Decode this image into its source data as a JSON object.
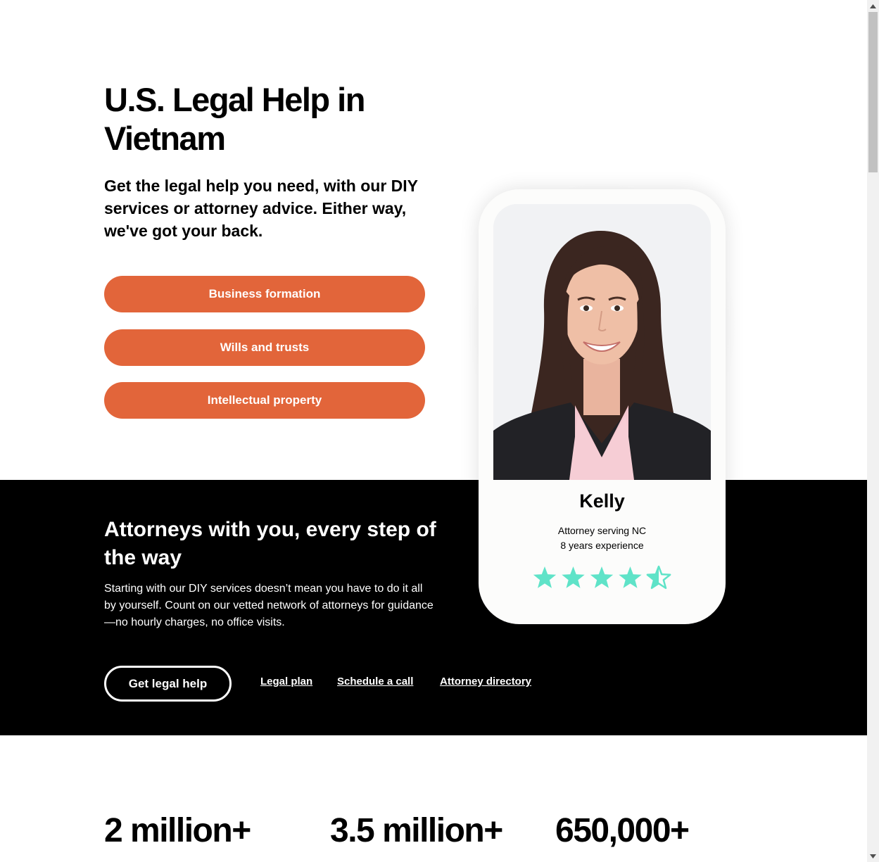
{
  "hero": {
    "title": "U.S. Legal Help in Vietnam",
    "subtitle": "Get the legal help you need, with our DIY services or attorney advice. Either way, we've got your back.",
    "buttons": [
      "Business formation",
      "Wills and trusts",
      "Intellectual property"
    ]
  },
  "band": {
    "title": "Attorneys with you, every step of the way",
    "text": "Starting with our DIY services doesn’t mean you have to do it all by yourself. Count on our vetted network of attorneys for guidance—no hourly charges, no office visits.",
    "primary_button": "Get legal help",
    "links": [
      "Legal plan",
      "Schedule a call",
      "Attorney directory"
    ]
  },
  "attorney_card": {
    "name": "Kelly",
    "role": "Attorney serving NC",
    "experience": "8 years experience",
    "rating": 4.5,
    "rating_max": 5,
    "star_color": "#5fe3c8",
    "photo_icon": "attorney-portrait-photo"
  },
  "stats": [
    "2 million+",
    "3.5 million+",
    "650,000+"
  ],
  "colors": {
    "accent": "#e2653a",
    "band": "#000000",
    "card": "#fcfcfb"
  }
}
